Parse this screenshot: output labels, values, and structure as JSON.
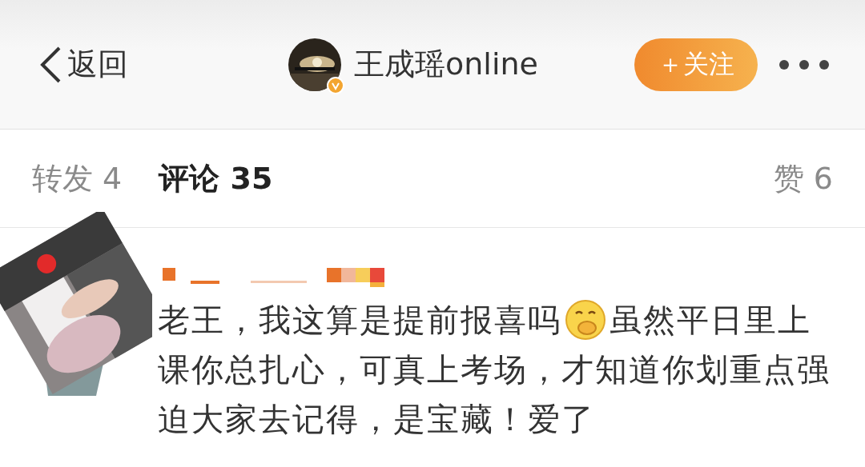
{
  "header": {
    "back_label": "返回",
    "account_name": "王成瑶online",
    "verified": true,
    "follow_label": "＋关注"
  },
  "tabs": [
    {
      "label": "转发 4",
      "selected": false
    },
    {
      "label": "评论 35",
      "selected": true
    },
    {
      "label": "赞 6",
      "selected": false
    }
  ],
  "comment": {
    "lines": [
      [
        "老王，我这算是提前报喜吗",
        "虽然平日里上"
      ],
      [
        "课你总扎心，可真上考场，才知道你划重点强"
      ],
      [
        "迫大家去记得，是宝藏！爱了"
      ]
    ]
  }
}
